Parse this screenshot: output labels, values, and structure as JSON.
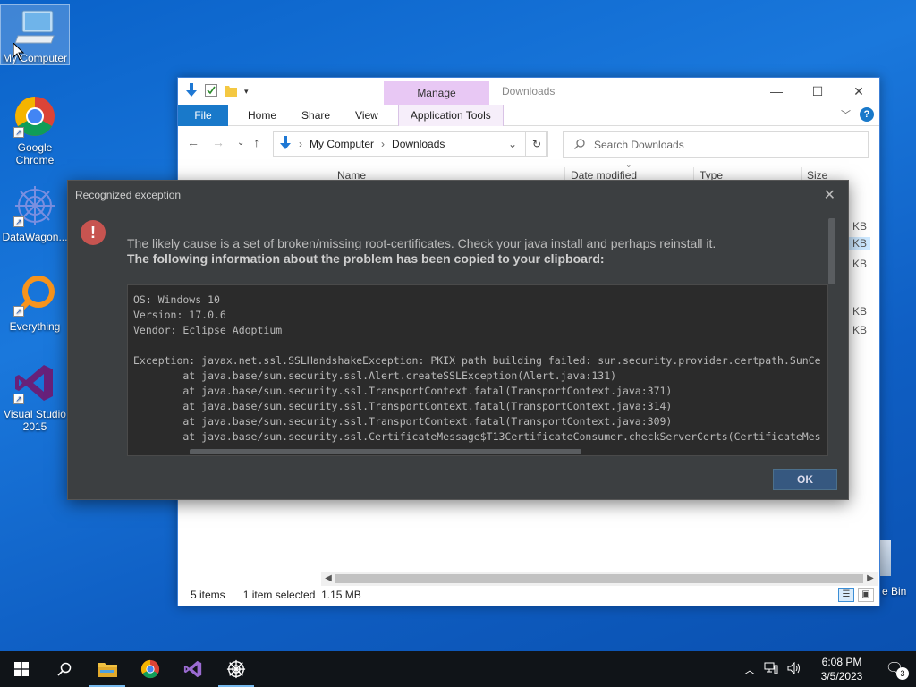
{
  "desktop": {
    "icons": [
      {
        "label": "My Computer"
      },
      {
        "label": "Google Chrome"
      },
      {
        "label": "DataWagon..."
      },
      {
        "label": "Everything"
      },
      {
        "label": "Visual Studio 2015"
      }
    ],
    "recycle_partial_label": "e Bin"
  },
  "explorer": {
    "title": "Downloads",
    "context_tab": "Manage",
    "ribbon": {
      "file": "File",
      "home": "Home",
      "share": "Share",
      "view": "View",
      "app_tools": "Application Tools"
    },
    "breadcrumb": [
      "My Computer",
      "Downloads"
    ],
    "search_placeholder": "Search Downloads",
    "columns": {
      "name": "Name",
      "date": "Date modified",
      "type": "Type",
      "size": "Size"
    },
    "size_fragments": [
      "KB",
      "KB",
      "KB",
      "KB",
      "KB"
    ],
    "status": {
      "items": "5 items",
      "selected": "1 item selected",
      "size": "1.15 MB"
    }
  },
  "dialog": {
    "title": "Recognized exception",
    "message": "The likely cause is a set of broken/missing root-certificates. Check your java install and perhaps reinstall it.",
    "message_bold": "The following information about the problem has been copied to your clipboard:",
    "details": [
      "OS: Windows 10",
      "Version: 17.0.6",
      "Vendor: Eclipse Adoptium",
      "",
      "Exception: javax.net.ssl.SSLHandshakeException: PKIX path building failed: sun.security.provider.certpath.SunCe",
      "        at java.base/sun.security.ssl.Alert.createSSLException(Alert.java:131)",
      "        at java.base/sun.security.ssl.TransportContext.fatal(TransportContext.java:371)",
      "        at java.base/sun.security.ssl.TransportContext.fatal(TransportContext.java:314)",
      "        at java.base/sun.security.ssl.TransportContext.fatal(TransportContext.java:309)",
      "        at java.base/sun.security.ssl.CertificateMessage$T13CertificateConsumer.checkServerCerts(CertificateMes"
    ],
    "ok": "OK"
  },
  "taskbar": {
    "time": "6:08 PM",
    "date": "3/5/2023",
    "notification_count": "3"
  },
  "colors": {
    "dialog_bg": "#3c3f41",
    "ok_button": "#365880",
    "error_red": "#c75450",
    "file_tab": "#1979ca",
    "manage_tab": "#e8c8f4"
  }
}
